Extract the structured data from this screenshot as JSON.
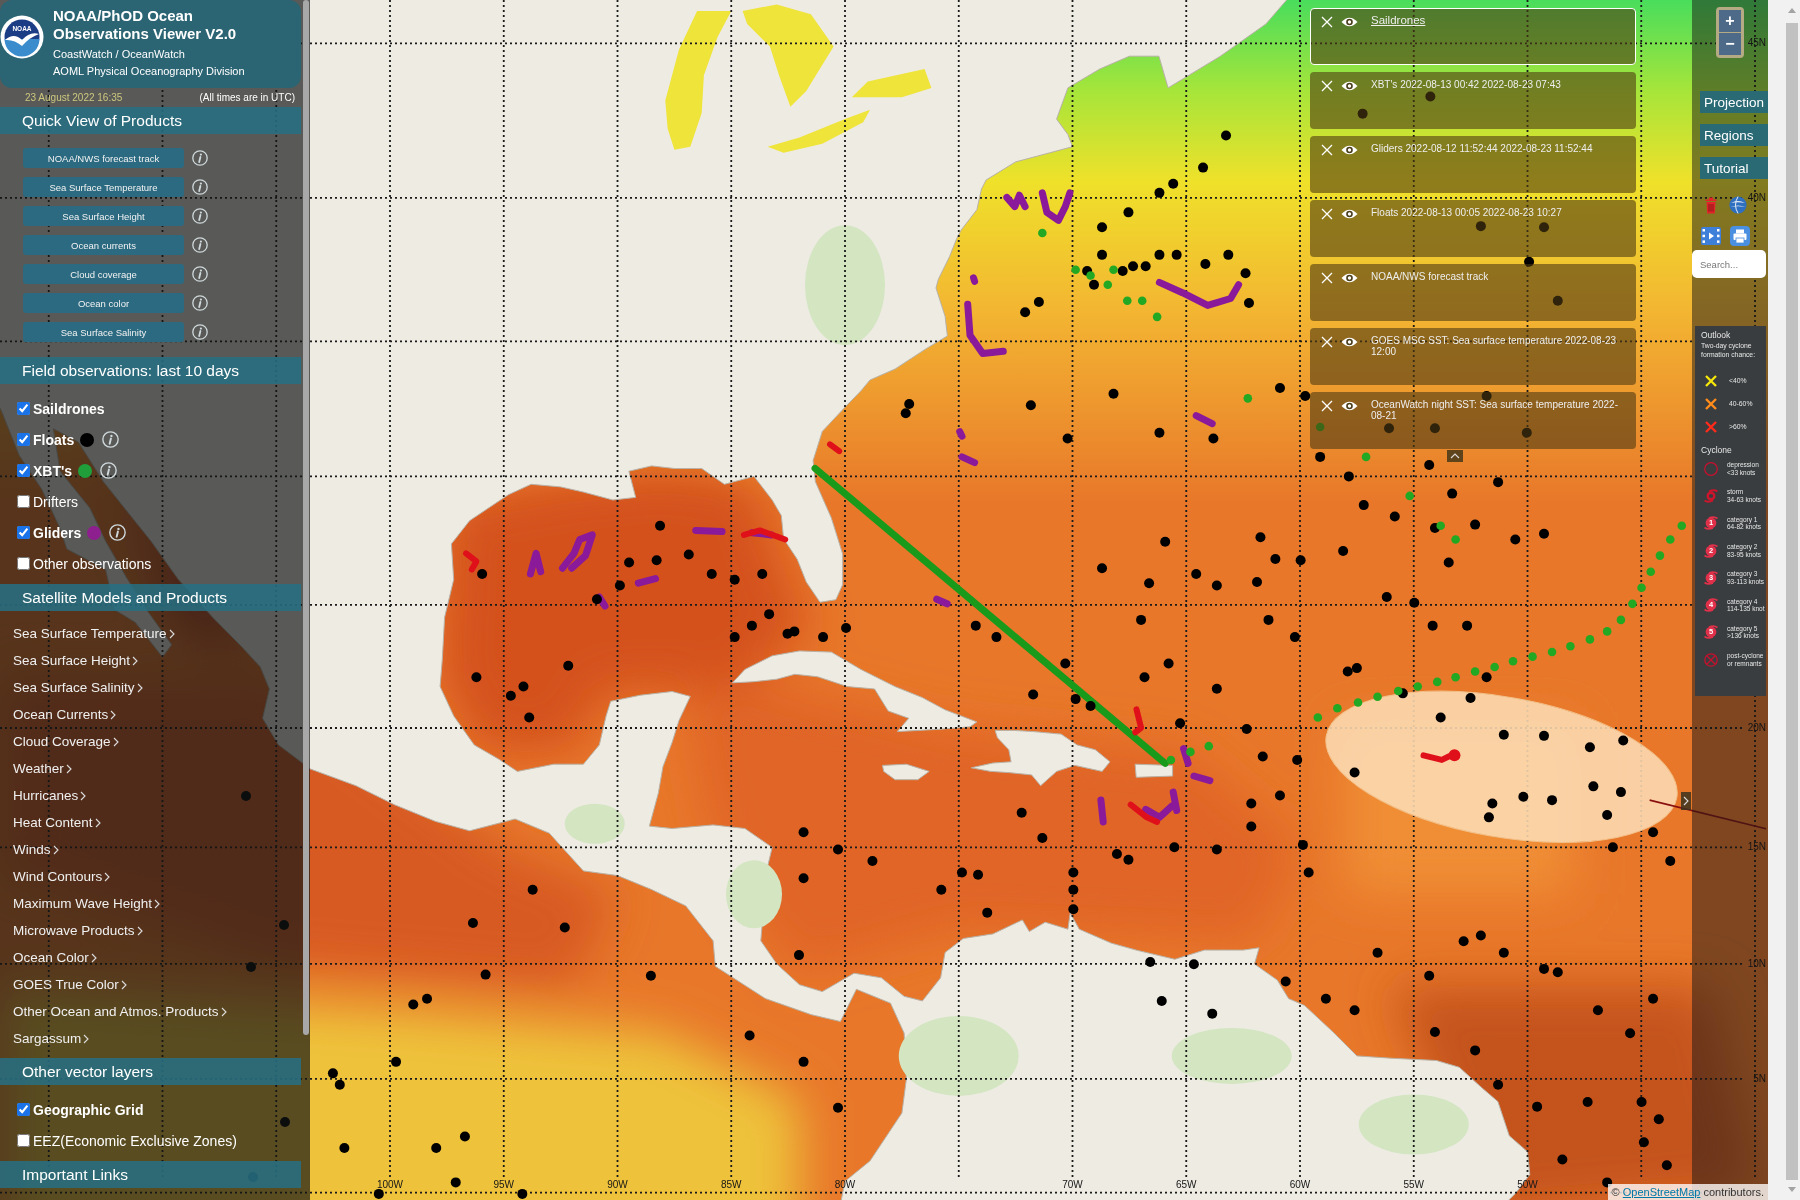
{
  "header": {
    "logo_text": "NOAA",
    "title": "NOAA/PhOD Ocean Observations Viewer V2.0",
    "subtitle": "CoastWatch / OceanWatch",
    "division": "AOML Physical Oceanography Division"
  },
  "status": {
    "date": "23 August 2022 16:35",
    "timezone_note": "(All times are in UTC)"
  },
  "sections": [
    {
      "kind": "buttons",
      "title": "Quick View of Products",
      "items": [
        {
          "label": "NOAA/NWS forecast track"
        },
        {
          "label": "Sea Surface Temperature"
        },
        {
          "label": "Sea Surface Height"
        },
        {
          "label": "Ocean currents"
        },
        {
          "label": "Cloud coverage"
        },
        {
          "label": "Ocean color"
        },
        {
          "label": "Sea Surface Salinity"
        }
      ]
    },
    {
      "kind": "checkboxes",
      "title": "Field observations: last 10 days",
      "items": [
        {
          "label": "Saildrones",
          "checked": true,
          "info": false
        },
        {
          "label": "Floats",
          "checked": true,
          "color": "#000000",
          "info": true
        },
        {
          "label": "XBT's",
          "checked": true,
          "color": "#1f9e3a",
          "info": true
        },
        {
          "label": "Drifters",
          "checked": false,
          "info": false
        },
        {
          "label": "Gliders",
          "checked": true,
          "color": "#8e1f8e",
          "info": true
        },
        {
          "label": "Other observations",
          "checked": false,
          "info": false
        }
      ]
    },
    {
      "kind": "menu",
      "title": "Satellite Models and Products",
      "items": [
        {
          "label": "Sea Surface Temperature"
        },
        {
          "label": "Sea Surface Height"
        },
        {
          "label": "Sea Surface Salinity"
        },
        {
          "label": "Ocean Currents"
        },
        {
          "label": "Cloud Coverage"
        },
        {
          "label": "Weather"
        },
        {
          "label": "Hurricanes"
        },
        {
          "label": "Heat Content"
        },
        {
          "label": "Winds"
        },
        {
          "label": "Wind Contours"
        },
        {
          "label": "Maximum Wave Height"
        },
        {
          "label": "Microwave Products"
        },
        {
          "label": "Ocean Color"
        },
        {
          "label": "GOES True Color"
        },
        {
          "label": "Other Ocean and Atmos. Products"
        },
        {
          "label": "Sargassum"
        }
      ]
    },
    {
      "kind": "checkboxes",
      "title": "Other vector layers",
      "items": [
        {
          "label": "Geographic Grid",
          "checked": true
        },
        {
          "label": "EEZ(Economic Exclusive Zones)",
          "checked": false
        }
      ]
    },
    {
      "kind": "links",
      "title": "Important Links"
    }
  ],
  "layers": [
    {
      "title": "Saildrones",
      "selected": true
    },
    {
      "title": "XBT's 2022-08-13 00:42 2022-08-23 07:43",
      "selected": false
    },
    {
      "title": "Gliders 2022-08-12 11:52:44 2022-08-23 11:52:44",
      "selected": false
    },
    {
      "title": "Floats 2022-08-13 00:05 2022-08-23 10:27",
      "selected": false
    },
    {
      "title": "NOAA/NWS forecast track",
      "selected": false
    },
    {
      "title": "GOES MSG SST: Sea surface temperature 2022-08-23 12:00",
      "selected": false
    },
    {
      "title": "OceanWatch night SST: Sea surface temperature 2022-08-21",
      "selected": false
    }
  ],
  "toolbar": {
    "zoom_in": "+",
    "zoom_out": "−",
    "buttons": [
      "Projection",
      "Regions",
      "Tutorial"
    ],
    "search": {
      "placeholder": "Search..."
    }
  },
  "legend": {
    "outlook_title": "Outlook",
    "outlook_caption": "Two-day cyclone formation chance:",
    "outlook": [
      {
        "label": "<40%",
        "color": "#f5e50a"
      },
      {
        "label": "40-60%",
        "color": "#ff8c1a"
      },
      {
        "label": ">60%",
        "color": "#ff2a1a"
      }
    ],
    "cyclone_title": "Cyclone",
    "cyclone": [
      {
        "kind": "depression",
        "label": "depression",
        "detail": "<33 knots"
      },
      {
        "kind": "storm",
        "label": "storm",
        "detail": "34-63 knots"
      },
      {
        "kind": "hurricane",
        "number": "1",
        "label": "category 1",
        "detail": "64-82 knots"
      },
      {
        "kind": "hurricane",
        "number": "2",
        "label": "category 2",
        "detail": "83-95 knots"
      },
      {
        "kind": "hurricane",
        "number": "3",
        "label": "category 3",
        "detail": "93-113 knots"
      },
      {
        "kind": "hurricane",
        "number": "4",
        "label": "category 4",
        "detail": "114-135 knot"
      },
      {
        "kind": "hurricane",
        "number": "5",
        "label": "category 5",
        "detail": ">136 knots"
      },
      {
        "kind": "remnant",
        "label": "post-cyclone",
        "detail": "or remnants"
      }
    ]
  },
  "map": {
    "lat_labels": [
      "45N",
      "40N",
      "20N",
      "15N",
      "10N",
      "5N"
    ],
    "lon_labels": [
      "100W",
      "95W",
      "90W",
      "85W",
      "80W",
      "70W",
      "65W",
      "60W",
      "55W",
      "50W"
    ],
    "attribution": {
      "prefix": "©",
      "link": "OpenStreetMap",
      "suffix": "contributors."
    }
  }
}
